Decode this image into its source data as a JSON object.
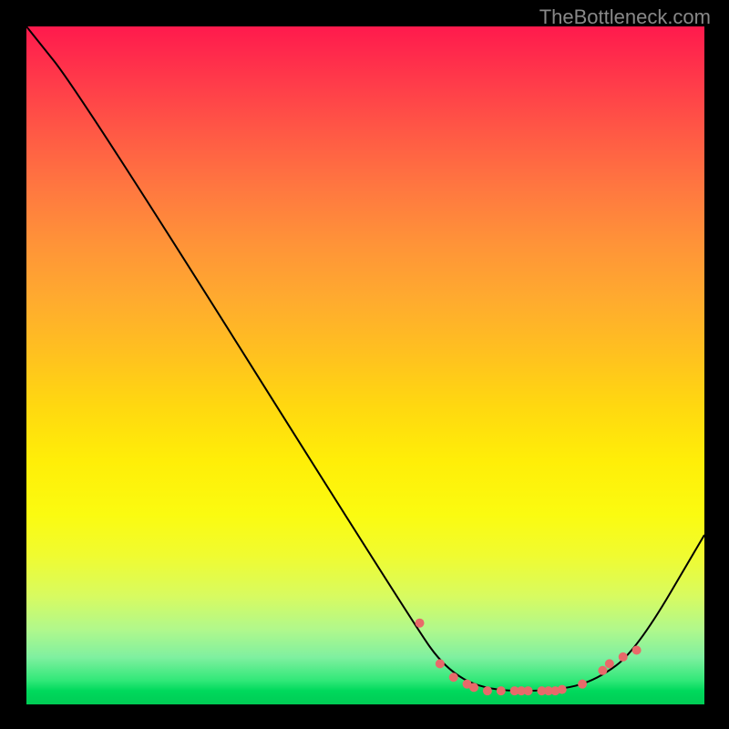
{
  "watermark": "TheBottleneck.com",
  "chart_data": {
    "type": "line",
    "title": "",
    "xlabel": "",
    "ylabel": "",
    "xlim": [
      0,
      100
    ],
    "ylim": [
      0,
      100
    ],
    "curve_points": [
      {
        "x": 0,
        "y": 100
      },
      {
        "x": 8,
        "y": 90
      },
      {
        "x": 57,
        "y": 12
      },
      {
        "x": 62,
        "y": 5
      },
      {
        "x": 68,
        "y": 2
      },
      {
        "x": 78,
        "y": 2
      },
      {
        "x": 84,
        "y": 3.5
      },
      {
        "x": 90,
        "y": 8
      },
      {
        "x": 100,
        "y": 25
      }
    ],
    "data_points": [
      {
        "x": 58,
        "y": 12
      },
      {
        "x": 61,
        "y": 6
      },
      {
        "x": 63,
        "y": 4
      },
      {
        "x": 65,
        "y": 3
      },
      {
        "x": 66,
        "y": 2.5
      },
      {
        "x": 68,
        "y": 2
      },
      {
        "x": 70,
        "y": 2
      },
      {
        "x": 72,
        "y": 2
      },
      {
        "x": 73,
        "y": 2
      },
      {
        "x": 74,
        "y": 2
      },
      {
        "x": 76,
        "y": 2
      },
      {
        "x": 77,
        "y": 2
      },
      {
        "x": 78,
        "y": 2
      },
      {
        "x": 79,
        "y": 2.2
      },
      {
        "x": 82,
        "y": 3
      },
      {
        "x": 85,
        "y": 5
      },
      {
        "x": 86,
        "y": 6
      },
      {
        "x": 88,
        "y": 7
      },
      {
        "x": 90,
        "y": 8
      }
    ],
    "gradient_description": "vertical gradient red-orange-yellow-green representing bottleneck severity (top=high, bottom=low)"
  }
}
